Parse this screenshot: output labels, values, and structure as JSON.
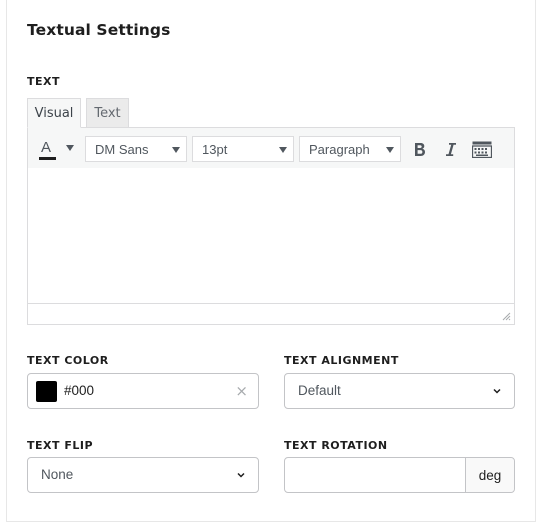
{
  "panel": {
    "title": "Textual Settings"
  },
  "text_section": {
    "label": "TEXT",
    "tabs": [
      {
        "label": "Visual",
        "active": true
      },
      {
        "label": "Text",
        "active": false
      }
    ],
    "toolbar": {
      "color_letter": "A",
      "font_family": "DM Sans",
      "font_size": "13pt",
      "block_format": "Paragraph",
      "bold_icon": "bold-icon",
      "italic_icon": "italic-icon",
      "toolbar_toggle_icon": "keyboard-icon"
    },
    "content": ""
  },
  "text_color": {
    "label": "TEXT COLOR",
    "value": "#000",
    "swatch": "#000000",
    "clear_glyph": "×"
  },
  "text_alignment": {
    "label": "TEXT ALIGNMENT",
    "value": "Default"
  },
  "text_flip": {
    "label": "TEXT FLIP",
    "value": "None"
  },
  "text_rotation": {
    "label": "TEXT ROTATION",
    "value": "",
    "unit": "deg"
  }
}
